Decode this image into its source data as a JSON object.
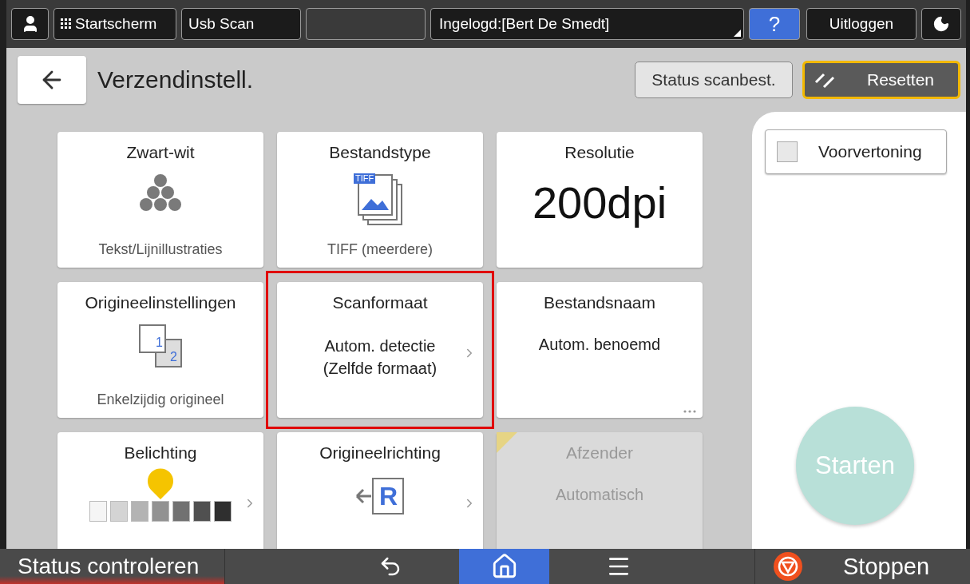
{
  "top_bar": {
    "home_label": "Startscherm",
    "app_label": "Usb Scan",
    "login": "Ingelogd:[Bert De Smedt]",
    "help": "?",
    "logout": "Uitloggen"
  },
  "header": {
    "title": "Verzendinstell.",
    "status_button": "Status scanbest.",
    "reset_button": "Resetten"
  },
  "tiles": [
    {
      "kind": "dots",
      "title": "Zwart-wit",
      "value": "Tekst/Lijnillustraties",
      "chevron": false,
      "more": false,
      "highlighted": false,
      "disabled": false
    },
    {
      "kind": "tiff",
      "icon_text": [
        "TIFF"
      ],
      "title": "Bestandstype",
      "value": "TIFF (meerdere)",
      "chevron": false,
      "more": false,
      "highlighted": false,
      "disabled": false
    },
    {
      "kind": "big",
      "title": "Resolutie",
      "value": "200dpi",
      "chevron": false,
      "more": false,
      "highlighted": false,
      "disabled": false
    },
    {
      "kind": "pages",
      "icon_text": [
        "1",
        "2"
      ],
      "title": "Origineelinstellingen",
      "value": "Enkelzijdig origineel",
      "chevron": false,
      "more": false,
      "highlighted": false,
      "disabled": false
    },
    {
      "kind": "text",
      "title": "Scanformaat",
      "value": "Autom. detectie\n(Zelfde formaat)",
      "chevron": true,
      "more": false,
      "highlighted": true,
      "disabled": false
    },
    {
      "kind": "text",
      "title": "Bestandsnaam",
      "value": "Autom. benoemd",
      "chevron": false,
      "more": true,
      "highlighted": false,
      "disabled": false
    },
    {
      "kind": "slider",
      "title": "Belichting",
      "level": 0.5,
      "chevron": true,
      "more": false,
      "highlighted": false,
      "disabled": false
    },
    {
      "kind": "orient",
      "icon_text": [
        "R"
      ],
      "title": "Origineelrichting",
      "chevron": true,
      "more": false,
      "highlighted": false,
      "disabled": false
    },
    {
      "kind": "text",
      "title": "Afzender",
      "value": "Automatisch",
      "chevron": false,
      "more": false,
      "highlighted": false,
      "disabled": true
    }
  ],
  "side_panel": {
    "preview": {
      "label": "Voorvertoning",
      "checked": false
    },
    "start_button": {
      "label": "Starten",
      "disabled": true
    }
  },
  "bottom_bar": {
    "status": "Status controleren",
    "tabs": [
      {
        "kind": "back",
        "selected": false
      },
      {
        "kind": "home",
        "selected": true
      },
      {
        "kind": "menu",
        "selected": false
      }
    ],
    "stop": "Stoppen"
  }
}
